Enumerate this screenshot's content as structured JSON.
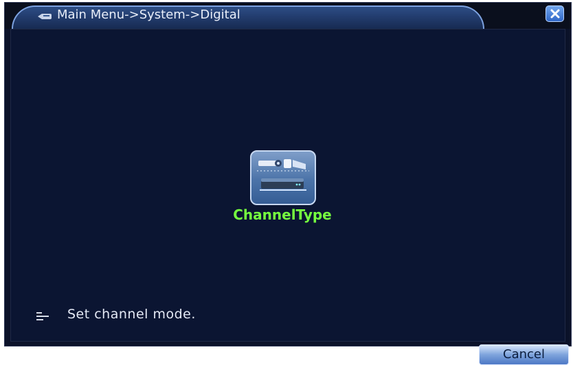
{
  "window": {
    "title": "Main Menu->System->Digital",
    "close_icon": "close-icon"
  },
  "main": {
    "channel_type": {
      "label": "ChannelType",
      "icon": "channel-type-icon"
    }
  },
  "status": {
    "icon": "info-icon",
    "text": "Set channel mode."
  },
  "footer": {
    "cancel_label": "Cancel"
  },
  "colors": {
    "background": "#0b1532",
    "titlebar": "#1f3766",
    "label_green": "#75ff3f",
    "button_blue": "#4d78c5"
  }
}
